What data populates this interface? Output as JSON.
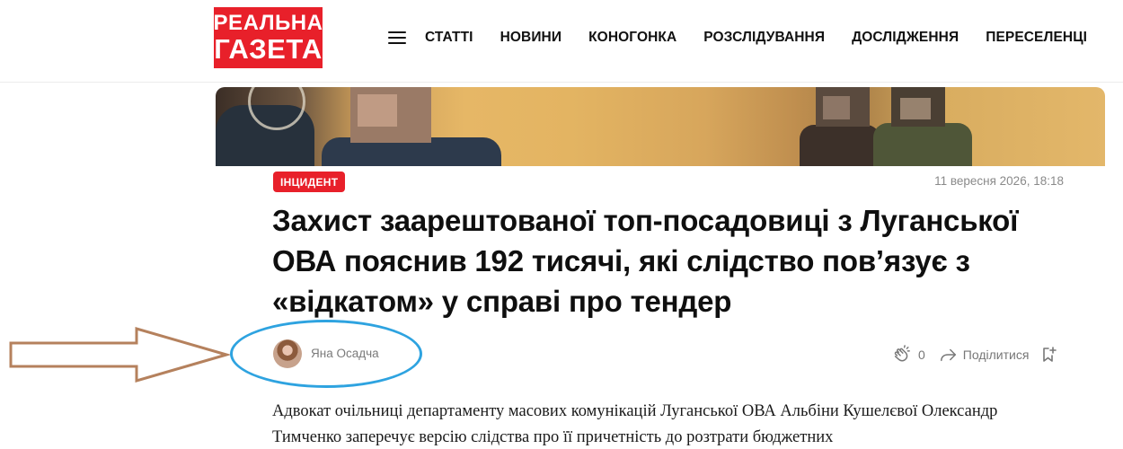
{
  "logo": {
    "line1": "РЕАЛЬНА",
    "line2": "ГАЗЕТА",
    "color": "#e8202a"
  },
  "nav": {
    "menu_icon": "hamburger-menu-icon",
    "items": [
      "СТАТТІ",
      "НОВИНИ",
      "КОНОГОНКА",
      "РОЗСЛІДУВАННЯ",
      "ДОСЛІДЖЕННЯ",
      "ПЕРЕСЕЛЕНЦІ"
    ]
  },
  "article": {
    "category": "ІНЦИДЕНТ",
    "date": "11 вересня 2026, 18:18",
    "title": "Захист заарештованої топ-посадовиці з Луганської ОВА пояснив 192 тисячі, які слідство пов’язує з «відкатом» у справі про тендер",
    "author": "Яна Осадча",
    "claps": "0",
    "share_label": "Поділитися",
    "lead": "Адвокат очільниці департаменту масових комунікацій Луганської ОВА Альбіни Кушелєвої Олександр Тимченко заперечує версію слідства про її причетність до розтрати бюджетних"
  },
  "annotation": {
    "arrow_color": "#b5815d",
    "ellipse_color": "#2ea3e0"
  }
}
